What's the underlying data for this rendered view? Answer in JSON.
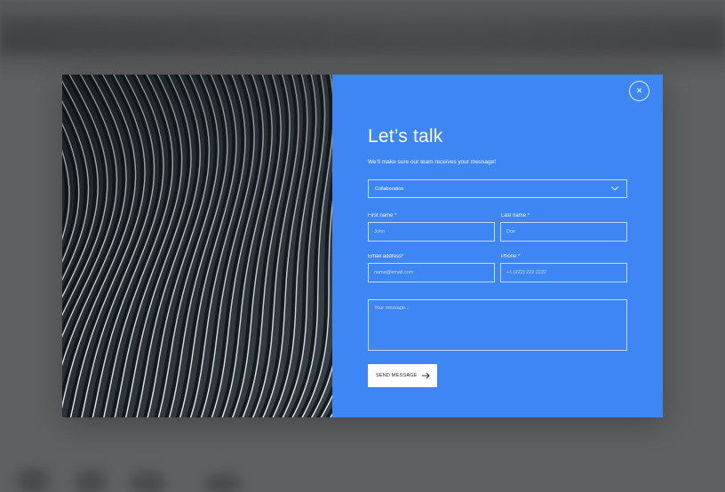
{
  "modal": {
    "title": "Let’s talk",
    "subtitle": "We’ll make sure our team receives your message!",
    "close_icon": "close-icon",
    "topic_select": {
      "value": "Collaboration",
      "icon": "chevron-down-icon"
    },
    "first_name": {
      "label": "First name *",
      "placeholder": "John"
    },
    "last_name": {
      "label": "Last name *",
      "placeholder": "Doe"
    },
    "email": {
      "label": "Email address*",
      "placeholder": "name@email.com"
    },
    "phone": {
      "label": "Phone *",
      "placeholder": "+1 (222) 222 2222"
    },
    "message": {
      "placeholder": "Your message..."
    },
    "send_button": {
      "label": "SEND MESSAGE",
      "icon": "arrow-right-icon"
    }
  },
  "colors": {
    "form_background": "#3d86f4",
    "overlay": "#5f6062",
    "button_background": "#ffffff"
  }
}
